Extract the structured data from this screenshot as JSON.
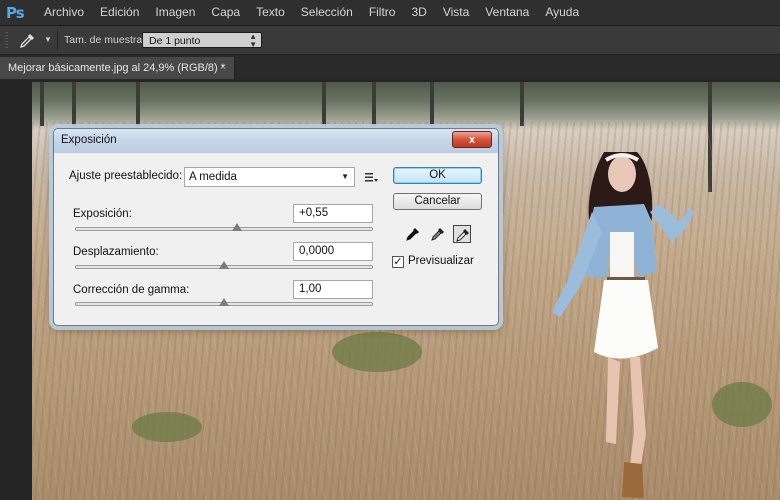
{
  "app": {
    "logo": "Ps",
    "accent": "#5aa7e0"
  },
  "menu": [
    "Archivo",
    "Edición",
    "Imagen",
    "Capa",
    "Texto",
    "Selección",
    "Filtro",
    "3D",
    "Vista",
    "Ventana",
    "Ayuda"
  ],
  "options": {
    "tool_icon": "eyedropper-icon",
    "sample_size_label": "Tam. de muestra:",
    "sample_size_value": "De 1 punto"
  },
  "document_tab": {
    "title": "Mejorar básicamente.jpg al 24,9% (RGB/8) *",
    "close": "×"
  },
  "dialog": {
    "title": "Exposición",
    "close": "x",
    "preset_label": "Ajuste preestablecido:",
    "preset_value": "A medida",
    "exposure_label": "Exposición:",
    "exposure_value": "+0,55",
    "offset_label": "Desplazamiento:",
    "offset_value": "0,0000",
    "gamma_label": "Corrección de gamma:",
    "gamma_value": "1,00",
    "ok": "OK",
    "cancel": "Cancelar",
    "preview_label": "Previsualizar",
    "preview_checked": true,
    "sample_tools": [
      "black-point-eyedropper-icon",
      "gray-point-eyedropper-icon",
      "white-point-eyedropper-icon"
    ],
    "slider_positions": {
      "exposure": 0.545,
      "offset": 0.5,
      "gamma": 0.5
    }
  }
}
